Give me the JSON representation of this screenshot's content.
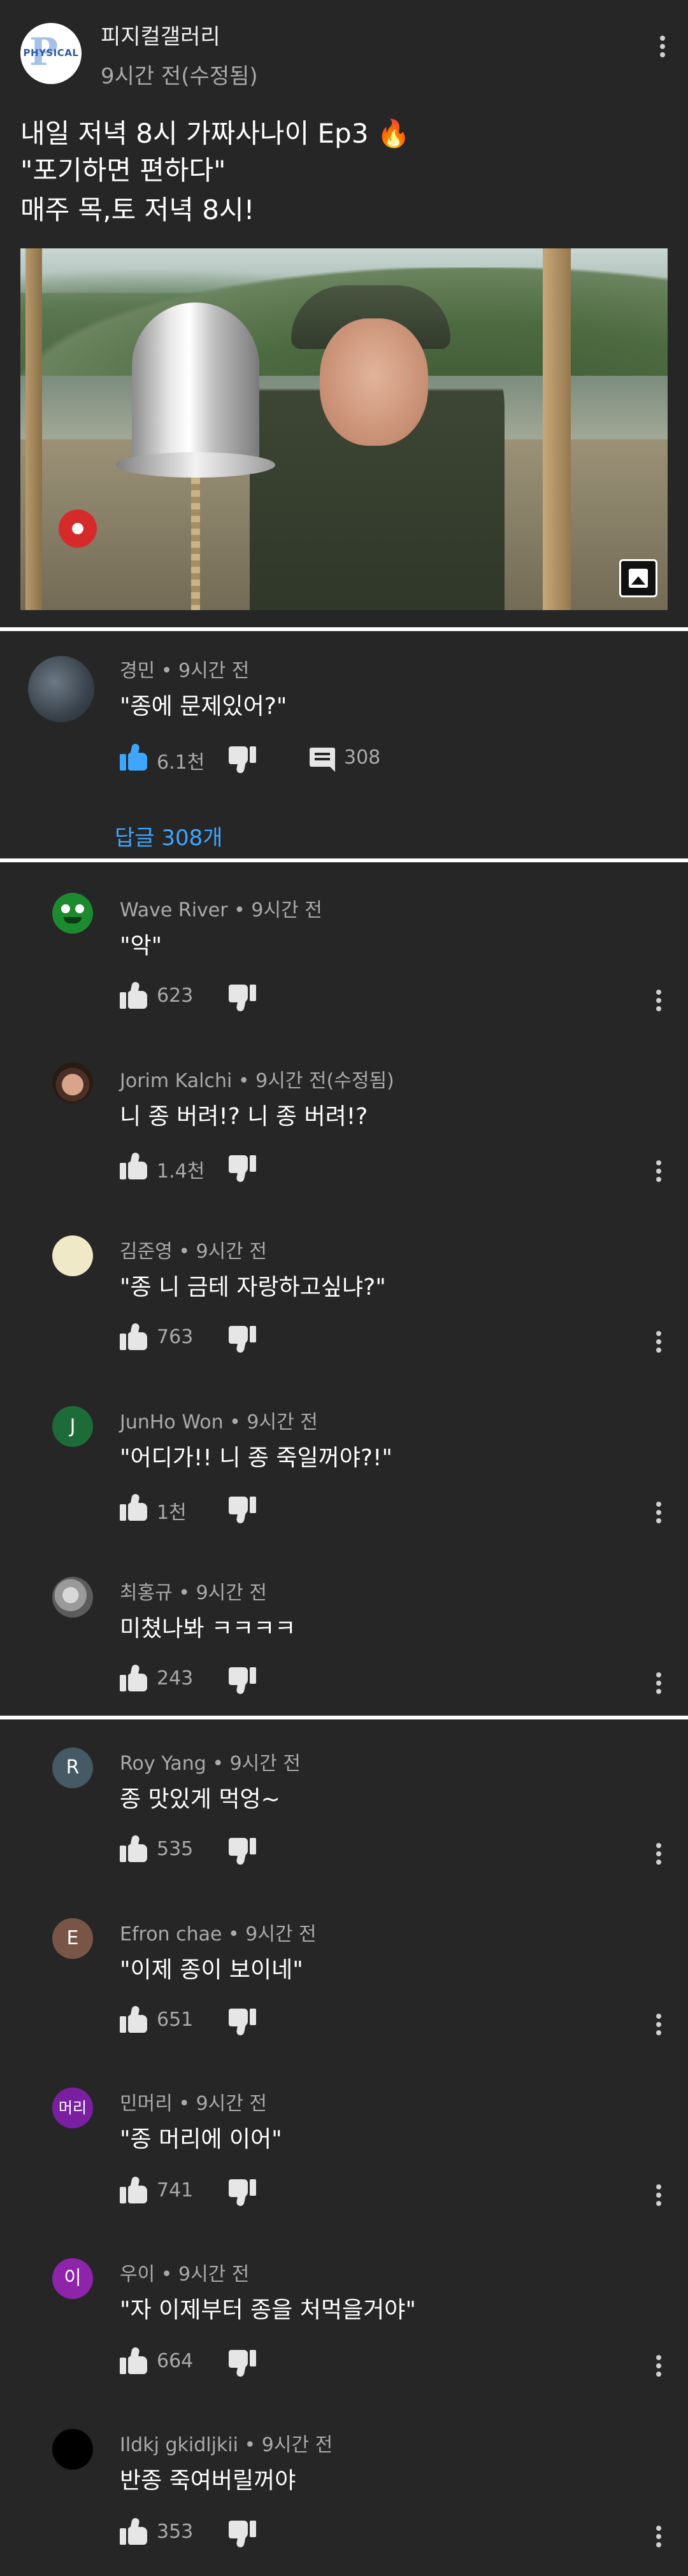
{
  "post": {
    "channel_name": "피지컬갤러리",
    "avatar_logo": "PHYSICAL",
    "time": "9시간 전(수정됨)",
    "lines": [
      "내일 저녁 8시 가짜사나이 Ep3",
      "\"포기하면 편하다\"",
      "매주 목,토 저녁 8시!"
    ],
    "fire_emoji": "🔥"
  },
  "top_comment": {
    "author": "경민",
    "time": "9시간 전",
    "text": "\"종에 문제있어?\"",
    "likes": "6.1천",
    "replies": "308",
    "reply_link": "답글 308개"
  },
  "replies_group_1": [
    {
      "author": "Wave River",
      "time": "9시간 전",
      "text": "\"악\"",
      "likes": "623",
      "avatar": "green-face",
      "avatar_color": "#1c8a2e"
    },
    {
      "author": "Jorim Kalchi",
      "time": "9시간 전(수정됨)",
      "text": "니 종 버려!? 니 종 버려!?",
      "likes": "1.4천",
      "avatar": "photo",
      "avatar_color": "#6d4a3a"
    },
    {
      "author": "김준영",
      "time": "9시간 전",
      "text": "\"종 니 금테 자랑하고싶냐?\"",
      "likes": "763",
      "avatar": "cream",
      "avatar_color": "#efe9c8"
    },
    {
      "author": "JunHo Won",
      "time": "9시간 전",
      "text": "\"어디가!! 니 종 죽일꺼야?!\"",
      "likes": "1천",
      "avatar_letter": "J",
      "avatar_color": "#1e6b3a"
    },
    {
      "author": "최홍규",
      "time": "9시간 전",
      "text": "미쳤나봐 ㅋㅋㅋㅋ",
      "likes": "243",
      "avatar": "bulldog",
      "avatar_color": "#8f8f8f"
    }
  ],
  "replies_group_2": [
    {
      "author": "Roy Yang",
      "time": "9시간 전",
      "text": "종 맛있게 먹엉~",
      "likes": "535",
      "avatar_letter": "R",
      "avatar_color": "#455a64"
    },
    {
      "author": "Efron chae",
      "time": "9시간 전",
      "text": "\"이제 종이 보이네\"",
      "likes": "651",
      "avatar_letter": "E",
      "avatar_color": "#795548"
    },
    {
      "author": "민머리",
      "time": "9시간 전",
      "text": "\"종 머리에 이어\"",
      "likes": "741",
      "avatar_letter": "머리",
      "avatar_color": "#7b1fa2"
    },
    {
      "author": "우이",
      "time": "9시간 전",
      "text": "\"자 이제부터 종을 처먹을거야\"",
      "likes": "664",
      "avatar_letter": "이",
      "avatar_color": "#8e24aa"
    },
    {
      "author": "Ildkj gkidljkii",
      "time": "9시간 전",
      "text": "반종 죽여버릴꺼야",
      "likes": "353",
      "avatar": "black",
      "avatar_color": "#000000"
    }
  ],
  "icons": {
    "like": "thumbs-up-icon",
    "dislike": "thumbs-down-icon",
    "reply": "comment-icon",
    "more": "more-vert-icon",
    "image": "image-icon"
  },
  "colors": {
    "background": "#262626",
    "link": "#3ea6ff",
    "secondary_text": "#aaaaaa"
  }
}
